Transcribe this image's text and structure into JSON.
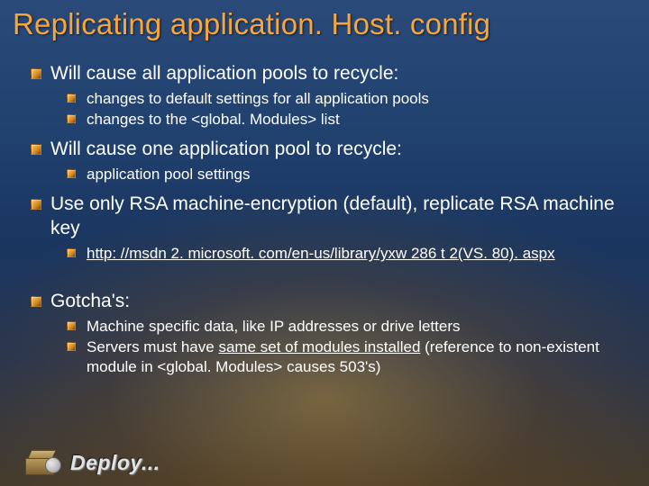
{
  "title": "Replicating application. Host. config",
  "footer": {
    "label": "Deploy..."
  },
  "link": {
    "text": "http: //msdn 2. microsoft. com/en-us/library/yxw 286 t 2(VS. 80). aspx",
    "href": "http://msdn2.microsoft.com/en-us/library/yxw286t2(VS.80).aspx"
  },
  "bullets": {
    "b1": "Will cause all application pools to recycle:",
    "b1a": "changes to default settings for all application pools",
    "b1b": "changes to the <global. Modules> list",
    "b2": "Will cause one application pool to recycle:",
    "b2a": "application pool settings",
    "b3": "Use only RSA machine-encryption (default), replicate RSA machine key",
    "b4": "Gotcha's:",
    "b4a": "Machine specific data, like IP addresses or drive letters",
    "b4b_pre": "Servers must have ",
    "b4b_u": "same set of modules installed",
    "b4b_post": " (reference to non-existent module in <global. Modules> causes 503's)"
  }
}
